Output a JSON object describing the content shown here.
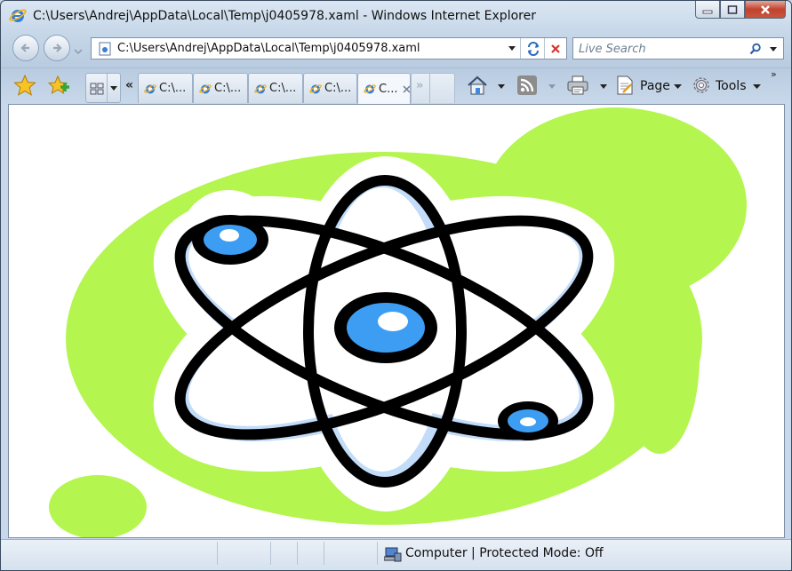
{
  "window": {
    "title": "C:\\Users\\Andrej\\AppData\\Local\\Temp\\j0405978.xaml - Windows Internet Explorer"
  },
  "address_bar": {
    "url": "C:\\Users\\Andrej\\AppData\\Local\\Temp\\j0405978.xaml"
  },
  "search": {
    "placeholder": "Live Search"
  },
  "tabs": [
    {
      "label": "C:\\..."
    },
    {
      "label": "C:\\..."
    },
    {
      "label": "C:\\..."
    },
    {
      "label": "C:\\..."
    },
    {
      "label": "C...",
      "active": true
    }
  ],
  "toolbar": {
    "quick_tabs_left": "«",
    "more_tabs": "»",
    "page_label": "Page",
    "tools_label": "Tools",
    "chevron_more": "»"
  },
  "status_bar": {
    "zone_text": "Computer | Protected Mode: Off"
  },
  "content": {
    "image": "atom-clipart",
    "colors": {
      "blob": "#b4f54f",
      "nucleus": "#3d9df3",
      "orbit_fill": "#c3dcf9",
      "stroke": "#000000"
    }
  }
}
